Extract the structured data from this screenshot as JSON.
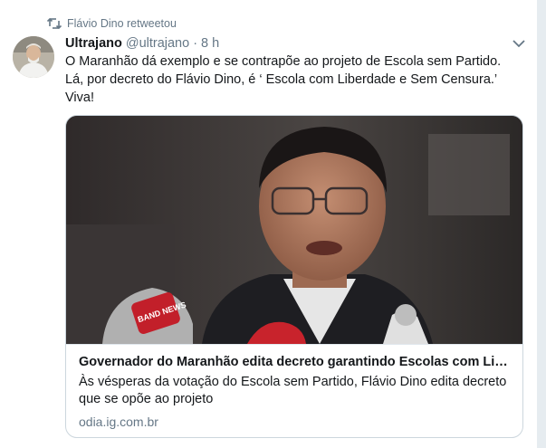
{
  "retweet_context": {
    "label": "Flávio Dino retweetou",
    "icon": "retweet-icon"
  },
  "author": {
    "name": "Ultrajano",
    "handle": "@ultrajano",
    "separator": "·",
    "time": "8 h"
  },
  "tweet_text": [
    "O Maranhão dá exemplo e se contrapõe ao projeto de Escola sem Partido.",
    "Lá, por decreto do Flávio Dino, é ‘ Escola com Liberdade e Sem Censura.’",
    "Viva!"
  ],
  "card": {
    "title": "Governador do Maranhão edita decreto garantindo Escolas com Liberdade",
    "description": "Às vésperas da votação do Escola sem Partido, Flávio Dino edita decreto que se opõe ao projeto",
    "domain": "odia.ig.com.br",
    "image_mic_label": "BAND NEWS"
  },
  "colors": {
    "secondary_text": "#657786",
    "border": "#ccd6dd",
    "background": "#e6ecf0"
  }
}
